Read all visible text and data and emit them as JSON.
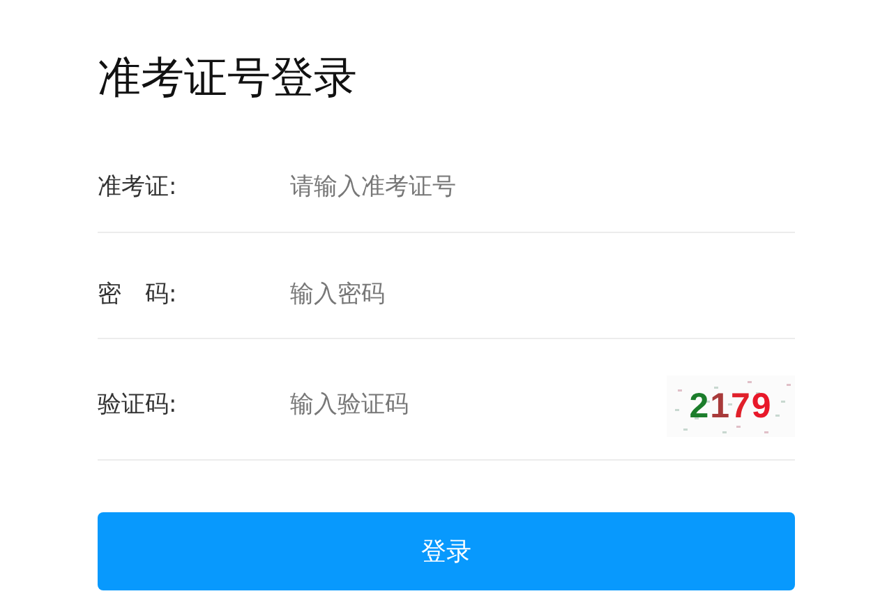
{
  "title": "准考证号登录",
  "fields": [
    {
      "label": "准考证:",
      "placeholder": "请输入准考证号",
      "kind": "text"
    },
    {
      "label": "密　码:",
      "placeholder": "输入密码",
      "kind": "password"
    },
    {
      "label": "验证码:",
      "placeholder": "输入验证码",
      "kind": "captcha"
    }
  ],
  "captcha": {
    "digits": [
      {
        "text": "2",
        "color": "#1b7d2b"
      },
      {
        "text": "1",
        "color": "#a83a3a"
      },
      {
        "text": "7",
        "color": "#e0202a"
      },
      {
        "text": "9",
        "color": "#e8182a"
      }
    ]
  },
  "submit": "登录"
}
